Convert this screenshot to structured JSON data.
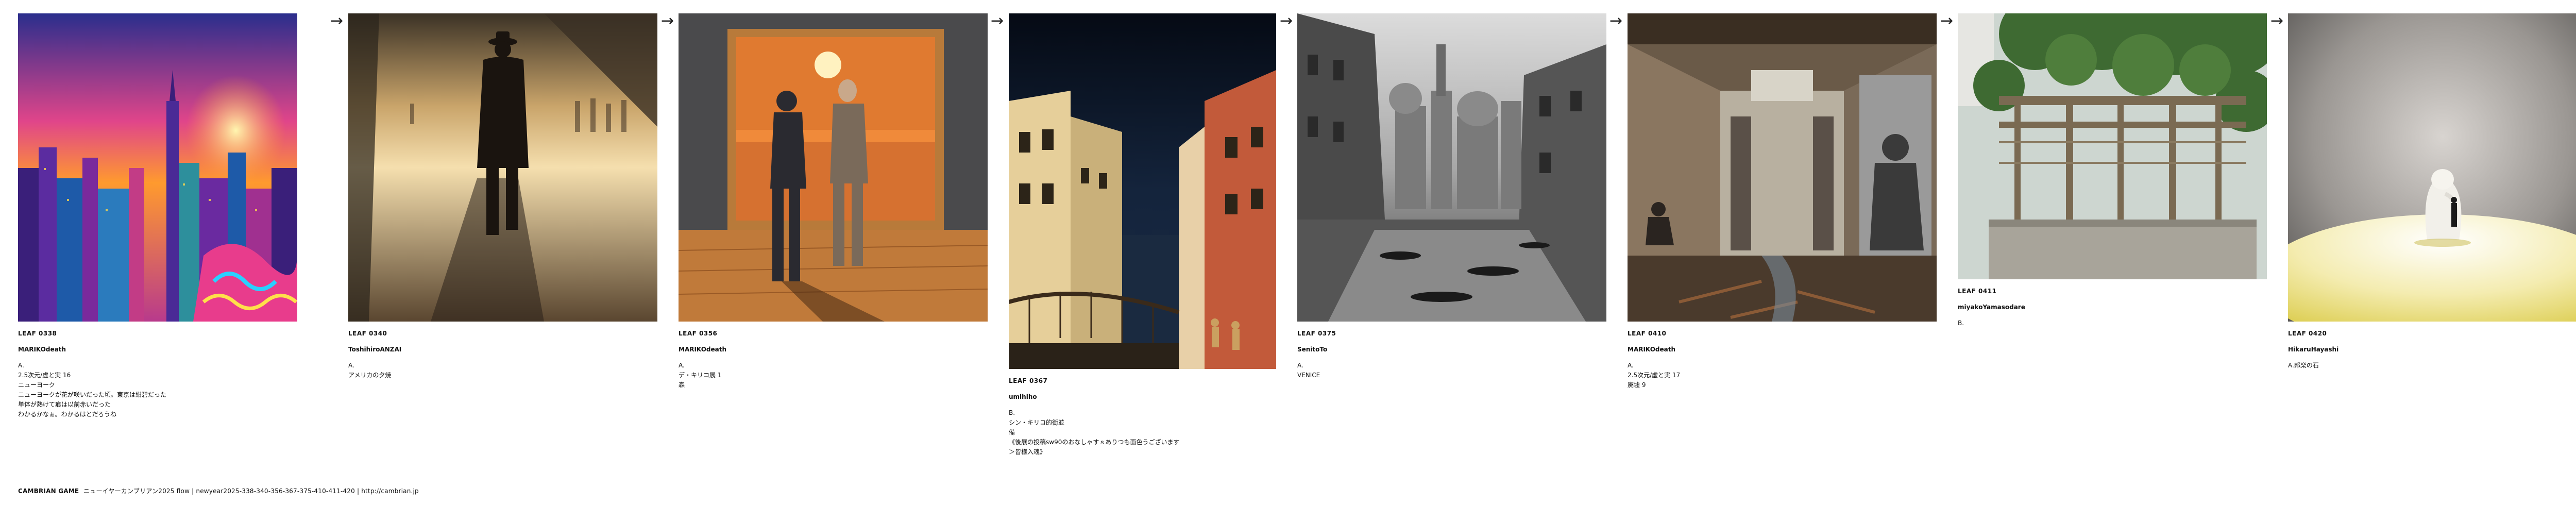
{
  "cards": [
    {
      "leaf": "LEAF 0338",
      "author": "MARIKOdeath",
      "body": "A.\n2.5次元/虚と実 16\nニューヨーク\nニューヨークが花が咲いだった頃。東京は紺碧だった\n単体が熱けて痕は以前赤いだった\nわかるかなぁ。わかるはとだろうね",
      "image": "neon-city-skyline"
    },
    {
      "leaf": "LEAF 0340",
      "author": "ToshihiroANZAI",
      "body": "A.\nアメリカの夕焼",
      "image": "man-walking-sunset"
    },
    {
      "leaf": "LEAF 0356",
      "author": "MARIKOdeath",
      "body": "A.\nデ・キリコ展 1\n森",
      "image": "two-men-painting"
    },
    {
      "leaf": "LEAF 0367",
      "author": "umihiho",
      "body": "B.\nシン・キリコ的街並\n備\n《後展の投稿sw90のおなしゃすｓありつも面色うございます\n＞皆様入魂》",
      "image": "venice-canal-night"
    },
    {
      "leaf": "LEAF 0375",
      "author": "SenitoTo",
      "body": "A.\nVENICE",
      "image": "venice-monochrome"
    },
    {
      "leaf": "LEAF 0410",
      "author": "MARIKOdeath",
      "body": "A.\n2.5次元/虚と実 17\n廃墟 9",
      "image": "ruined-alley-mural"
    },
    {
      "leaf": "LEAF 0411",
      "author": "miyakoYamasodare",
      "body": "B.",
      "image": "overgrown-ruin"
    },
    {
      "leaf": "LEAF 0420",
      "author": "HikaruHayashi",
      "body": "A.邦楽の石",
      "image": "sculpture-spotlight"
    }
  ],
  "arrow_glyph": "→",
  "footer": {
    "brand": "CAMBRIAN GAME",
    "text": "ニューイヤーカンブリアン2025  flow | newyear2025-338-340-356-367-375-410-411-420 |    http://cambrian.jp"
  }
}
